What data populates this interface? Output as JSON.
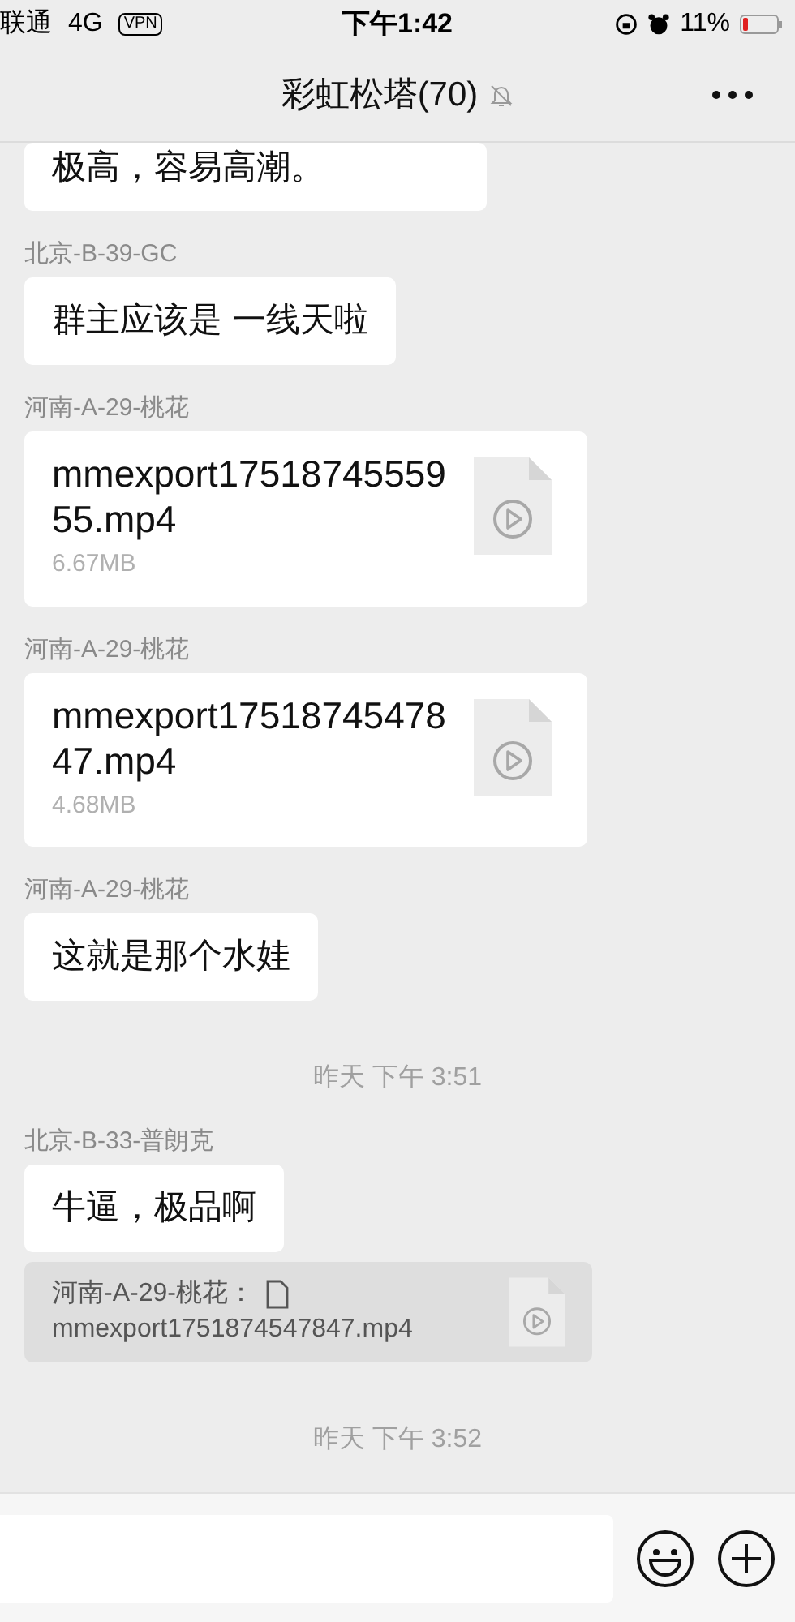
{
  "status_bar": {
    "carrier": "联通",
    "network": "4G",
    "vpn": "VPN",
    "time": "下午1:42",
    "battery": "11%"
  },
  "header": {
    "title": "彩虹松塔(70)",
    "muted": true
  },
  "messages": [
    {
      "kind": "text",
      "text": "极高，容易高潮。"
    },
    {
      "kind": "text",
      "sender": "北京-B-39-GC",
      "text": "群主应该是 一线天啦"
    },
    {
      "kind": "file",
      "sender": "河南-A-29-桃花",
      "filename": "mmexport1751874555955.mp4",
      "size": "6.67MB"
    },
    {
      "kind": "file",
      "sender": "河南-A-29-桃花",
      "filename": "mmexport1751874547847.mp4",
      "size": "4.68MB"
    },
    {
      "kind": "text",
      "sender": "河南-A-29-桃花",
      "text": "这就是那个水娃"
    },
    {
      "kind": "time",
      "text": "昨天 下午 3:51"
    },
    {
      "kind": "text",
      "sender": "北京-B-33-普朗克",
      "text": "牛逼，极品啊",
      "quote": {
        "sender": "河南-A-29-桃花：",
        "filename": "mmexport1751874547847.mp4"
      }
    },
    {
      "kind": "time",
      "text": "昨天 下午 3:52"
    }
  ]
}
